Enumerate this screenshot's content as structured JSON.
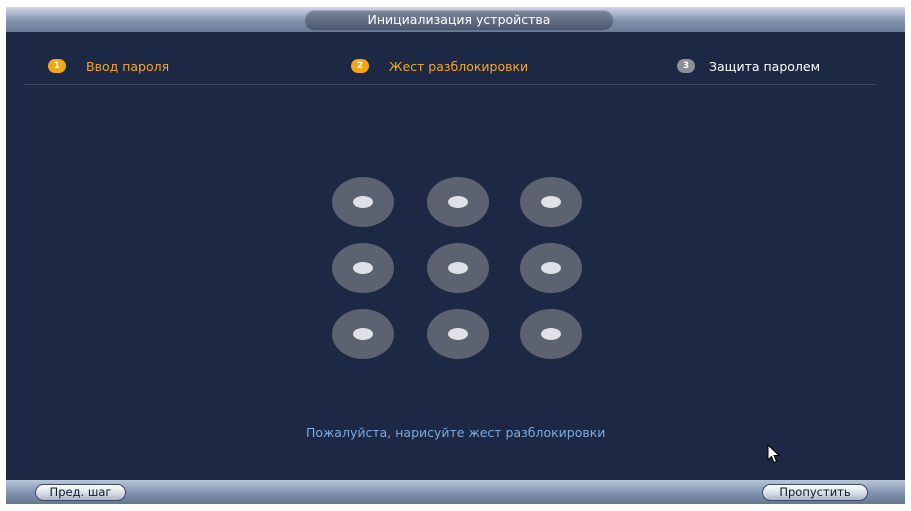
{
  "window": {
    "title": "Инициализация устройства"
  },
  "steps": [
    {
      "number": "1",
      "label": "Ввод пароля",
      "state": "done"
    },
    {
      "number": "2",
      "label": "Жест разблокировки",
      "state": "current"
    },
    {
      "number": "3",
      "label": "Защита паролем",
      "state": "pending"
    }
  ],
  "pattern": {
    "rows": 3,
    "cols": 3,
    "selected": []
  },
  "hint": "Пожалуйста, нарисуйте жест разблокировки",
  "footer": {
    "prev_label": "Пред. шаг",
    "skip_label": "Пропустить"
  },
  "colors": {
    "background": "#1c2844",
    "step_active": "#f2a61c",
    "step_inactive": "#8a8f98",
    "hint_text": "#7ea9dd",
    "dot_outer": "#5c6270",
    "dot_inner": "#dfe1e6"
  }
}
